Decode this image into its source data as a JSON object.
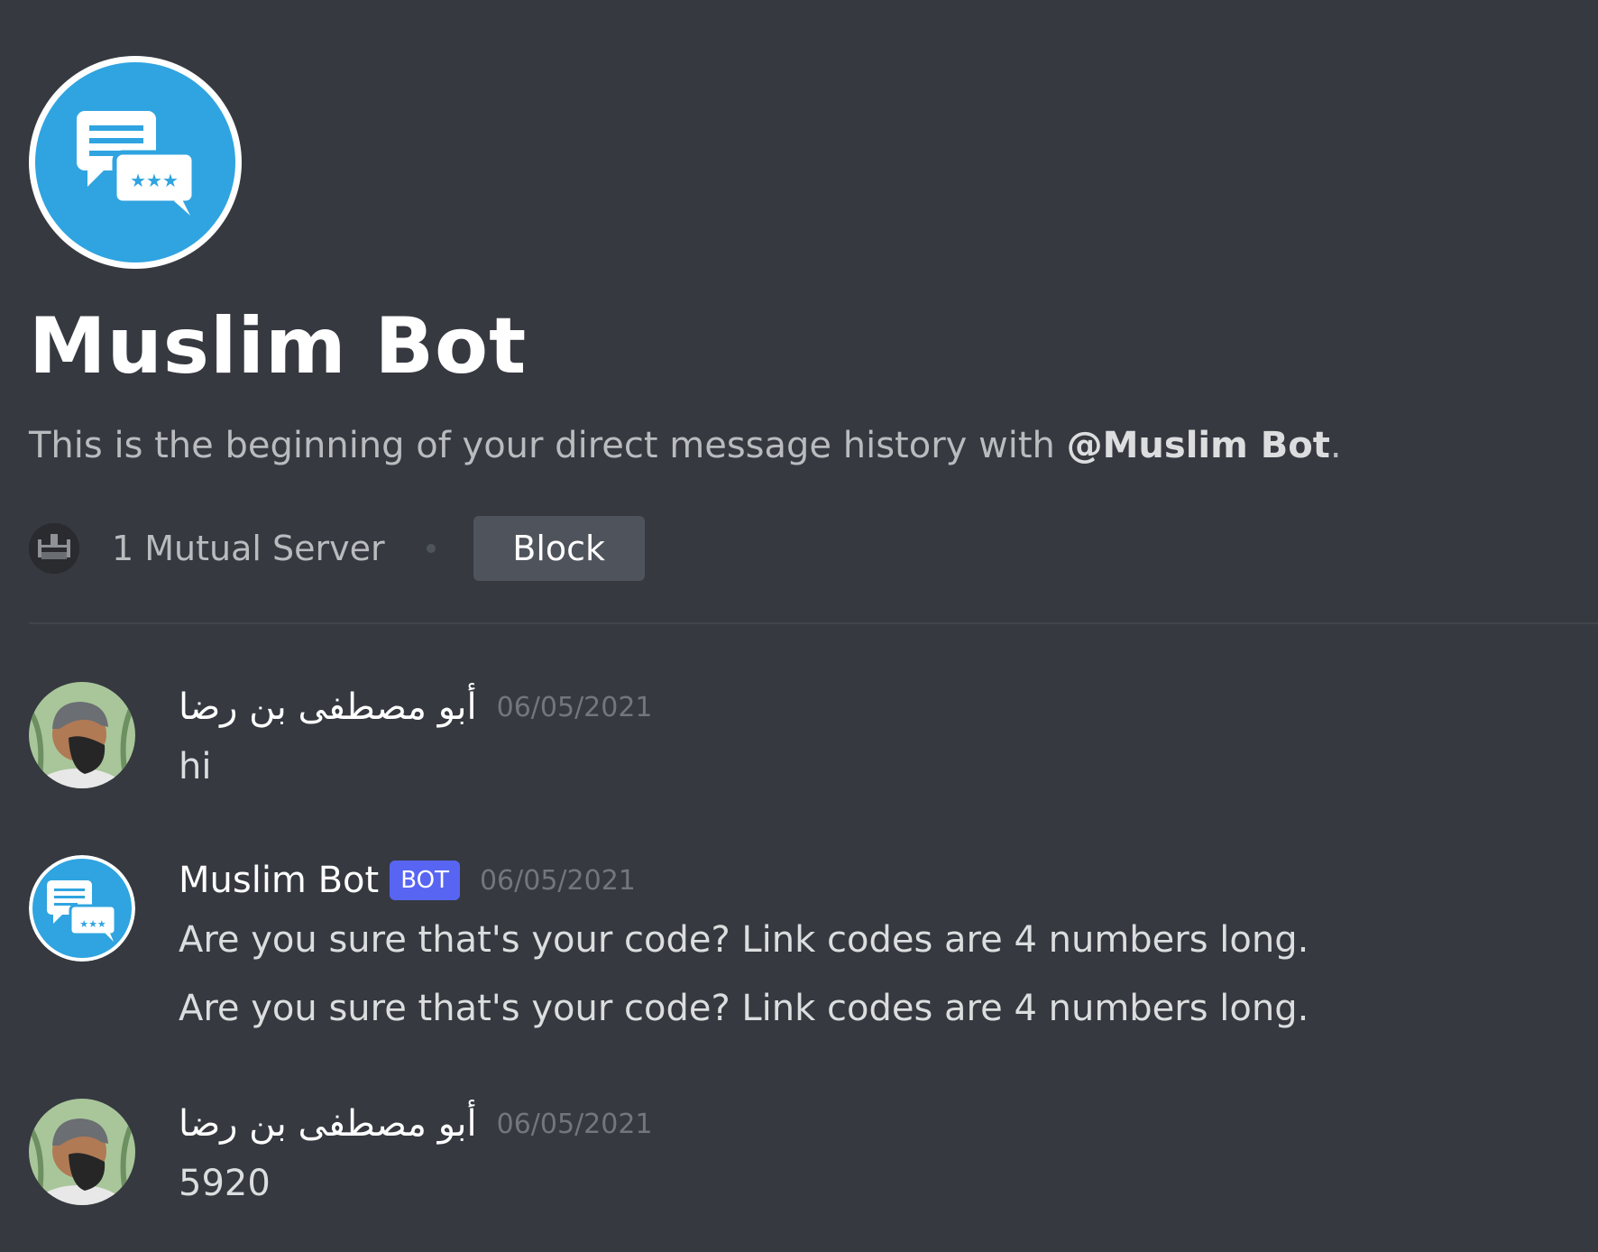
{
  "colors": {
    "background": "#363940",
    "bot_badge": "#5865f2",
    "avatar_blue": "#2fa4e0"
  },
  "profile": {
    "avatar_icon": "chat-bubbles-icon",
    "name": "Muslim Bot",
    "intro_prefix": "This is the beginning of your direct message history with ",
    "intro_mention": "@Muslim Bot",
    "intro_suffix": "."
  },
  "mutual": {
    "server_icon": "server-icon",
    "label": "1 Mutual Server",
    "block_label": "Block"
  },
  "messages": [
    {
      "author": "أبو مصطفى بن رضا",
      "avatar": "user-avatar",
      "timestamp": "06/05/2021",
      "lines": [
        "hi"
      ]
    },
    {
      "author": "Muslim Bot",
      "badge": "BOT",
      "avatar": "bot-avatar",
      "timestamp": "06/05/2021",
      "lines": [
        "Are you sure that's your code? Link codes are 4 numbers long.",
        "Are you sure that's your code? Link codes are 4 numbers long."
      ]
    },
    {
      "author": "أبو مصطفى بن رضا",
      "avatar": "user-avatar",
      "timestamp": "06/05/2021",
      "lines": [
        "5920"
      ]
    }
  ]
}
